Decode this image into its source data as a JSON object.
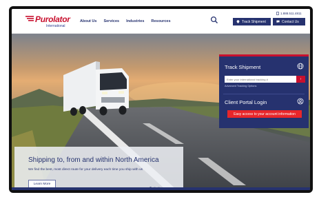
{
  "brand": {
    "name": "Purolator",
    "sub": "International",
    "color": "#c8102e",
    "navy": "#26326f"
  },
  "header": {
    "nav": [
      "About Us",
      "Services",
      "Industries",
      "Resources"
    ],
    "phone": "1.888.511.4811",
    "track_button": "Track Shipment",
    "contact_button": "Contact Us",
    "search_icon": "search-icon"
  },
  "track_panel": {
    "title": "Track Shipment",
    "input_placeholder": "Enter your international tracking #",
    "go_label": "›",
    "advanced_link": "Advanced Tracking Options",
    "portal_title": "Client Portal Login",
    "portal_button": "Easy access to your account information"
  },
  "hero": {
    "title": "Shipping to, from and within North America",
    "subtitle": "We find the best, most direct route for your delivery each time you ship with us",
    "cta": "Learn More",
    "slides": 3,
    "active_slide": 1
  }
}
